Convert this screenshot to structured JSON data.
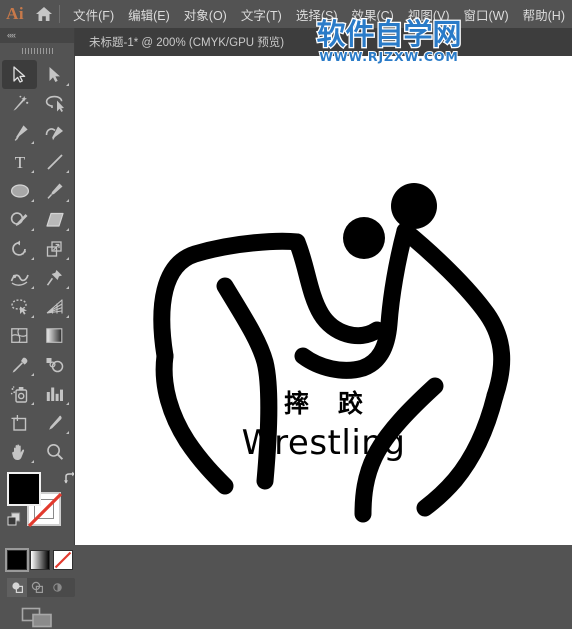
{
  "app": {
    "logo_text": "Ai",
    "home_icon": "home-icon"
  },
  "menubar": {
    "items": [
      {
        "label": "文件(F)",
        "name": "menu-file"
      },
      {
        "label": "编辑(E)",
        "name": "menu-edit"
      },
      {
        "label": "对象(O)",
        "name": "menu-object"
      },
      {
        "label": "文字(T)",
        "name": "menu-type"
      },
      {
        "label": "选择(S)",
        "name": "menu-select"
      },
      {
        "label": "效果(C)",
        "name": "menu-effect"
      },
      {
        "label": "视图(V)",
        "name": "menu-view"
      },
      {
        "label": "窗口(W)",
        "name": "menu-window"
      },
      {
        "label": "帮助(H)",
        "name": "menu-help"
      }
    ]
  },
  "tabbar": {
    "document_title": "未标题-1* @ 200% (CMYK/GPU 预览)"
  },
  "watermark": {
    "cn": "软件自学网",
    "url": "WWW.RJZXW.COM",
    "color": "#2a7bc8"
  },
  "canvas": {
    "background": "#ffffff",
    "artwork_name": "wrestling-pictogram",
    "label_cn": "摔 跤",
    "label_en": "Wrestling",
    "art_color": "#000000"
  },
  "toolbar": {
    "collapse_label": "««",
    "tools": [
      {
        "name": "selection-tool",
        "icon": "arrow-solid-icon",
        "active": true,
        "corner": false
      },
      {
        "name": "direct-selection-tool",
        "icon": "arrow-direct-icon",
        "active": false,
        "corner": true
      },
      {
        "name": "magic-wand-tool",
        "icon": "magic-wand-icon",
        "active": false,
        "corner": false
      },
      {
        "name": "lasso-tool",
        "icon": "lasso-icon",
        "active": false,
        "corner": false
      },
      {
        "name": "pen-tool",
        "icon": "pen-icon",
        "active": false,
        "corner": true
      },
      {
        "name": "curvature-tool",
        "icon": "curvature-icon",
        "active": false,
        "corner": false
      },
      {
        "name": "type-tool",
        "icon": "type-t-icon",
        "active": false,
        "corner": true
      },
      {
        "name": "line-segment-tool",
        "icon": "line-icon",
        "active": false,
        "corner": true
      },
      {
        "name": "ellipse-tool",
        "icon": "ellipse-icon",
        "active": false,
        "corner": true
      },
      {
        "name": "paintbrush-tool",
        "icon": "paintbrush-icon",
        "active": false,
        "corner": true
      },
      {
        "name": "shaper-tool",
        "icon": "shaper-pencil-icon",
        "active": false,
        "corner": true
      },
      {
        "name": "eraser-tool",
        "icon": "eraser-icon",
        "active": false,
        "corner": true
      },
      {
        "name": "rotate-tool",
        "icon": "rotate-icon",
        "active": false,
        "corner": true
      },
      {
        "name": "scale-tool",
        "icon": "scale-icon",
        "active": false,
        "corner": true
      },
      {
        "name": "width-warp-tool",
        "icon": "warp-icon",
        "active": false,
        "corner": true
      },
      {
        "name": "free-transform-tool",
        "icon": "pushpin-icon",
        "active": false,
        "corner": true
      },
      {
        "name": "shape-builder-tool",
        "icon": "shape-builder-icon",
        "active": false,
        "corner": true
      },
      {
        "name": "perspective-grid-tool",
        "icon": "perspective-grid-icon",
        "active": false,
        "corner": true
      },
      {
        "name": "mesh-tool",
        "icon": "mesh-icon",
        "active": false,
        "corner": false
      },
      {
        "name": "gradient-tool",
        "icon": "gradient-icon",
        "active": false,
        "corner": false
      },
      {
        "name": "eyedropper-tool",
        "icon": "eyedropper-icon",
        "active": false,
        "corner": true
      },
      {
        "name": "blend-tool",
        "icon": "blend-icon",
        "active": false,
        "corner": false
      },
      {
        "name": "symbol-sprayer-tool",
        "icon": "symbol-sprayer-icon",
        "active": false,
        "corner": true
      },
      {
        "name": "column-graph-tool",
        "icon": "bar-graph-icon",
        "active": false,
        "corner": true
      },
      {
        "name": "artboard-tool",
        "icon": "artboard-icon",
        "active": false,
        "corner": false
      },
      {
        "name": "slice-tool",
        "icon": "knife-icon",
        "active": false,
        "corner": true
      },
      {
        "name": "hand-tool",
        "icon": "hand-icon",
        "active": false,
        "corner": true
      },
      {
        "name": "zoom-tool",
        "icon": "magnifier-icon",
        "active": false,
        "corner": false
      }
    ],
    "fill_color": "#000000",
    "stroke_color": "#ffffff",
    "stroke_is_none": true,
    "swap_icon": "swap-fill-stroke-icon",
    "default_icon": "default-fill-stroke-icon",
    "mini_swatches": [
      {
        "name": "color-swatch",
        "type": "solid",
        "selected": true
      },
      {
        "name": "gradient-swatch",
        "type": "gradient",
        "selected": false
      },
      {
        "name": "none-swatch",
        "type": "none",
        "selected": false
      }
    ],
    "draw_modes": [
      {
        "name": "draw-normal-mode",
        "selected": true
      },
      {
        "name": "draw-behind-mode",
        "selected": false
      },
      {
        "name": "draw-inside-mode",
        "selected": false
      }
    ],
    "screen_mode_icon": "change-screen-mode-icon"
  }
}
